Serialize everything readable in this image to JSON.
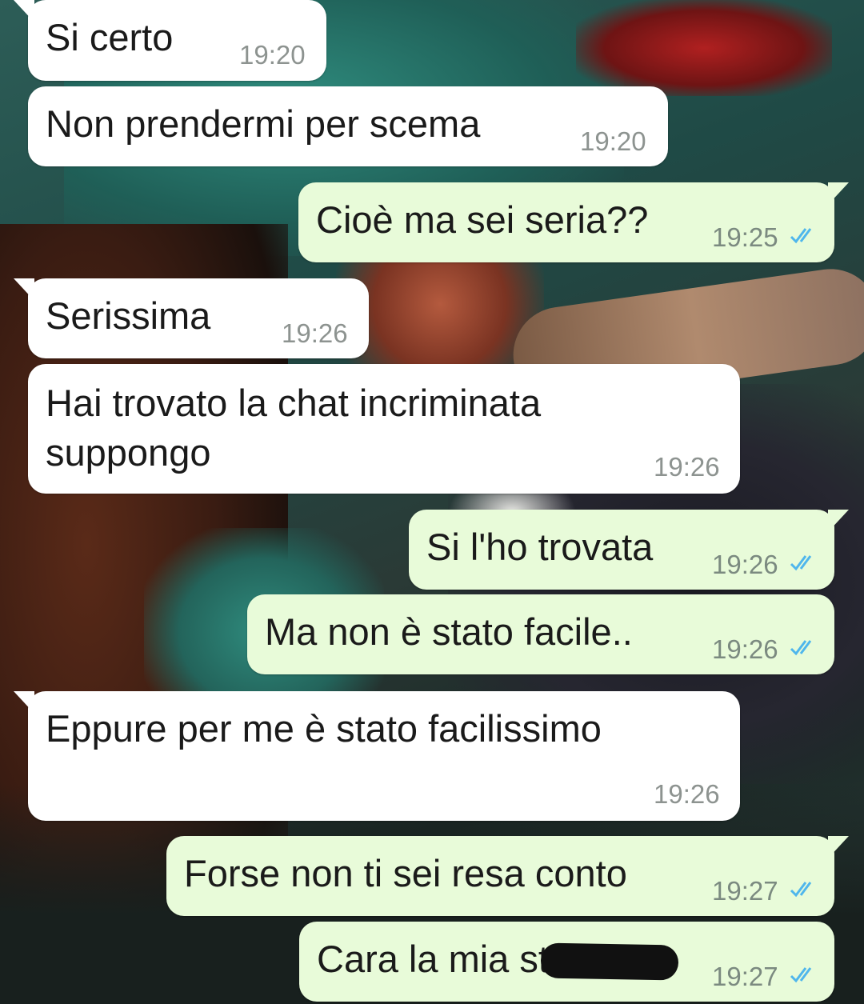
{
  "messages": [
    {
      "direction": "in",
      "text": "Si certo",
      "time": "19:20"
    },
    {
      "direction": "in",
      "text": "Non prendermi per scema",
      "time": "19:20"
    },
    {
      "direction": "out",
      "text": "Cioè ma sei seria??",
      "time": "19:25",
      "status": "double-check-icon"
    },
    {
      "direction": "in",
      "text": "Serissima",
      "time": "19:26"
    },
    {
      "direction": "in",
      "text": "Hai trovato la chat incriminata\nsuppongo",
      "time": "19:26"
    },
    {
      "direction": "out",
      "text": "Si l'ho trovata",
      "time": "19:26",
      "status": "double-check-icon"
    },
    {
      "direction": "out",
      "text": "Ma non è stato facile..",
      "time": "19:26",
      "status": "double-check-icon"
    },
    {
      "direction": "in",
      "text": "Eppure per me è stato facilissimo",
      "time": "19:26"
    },
    {
      "direction": "out",
      "text": "Forse non ti sei resa conto",
      "time": "19:27",
      "status": "double-check-icon"
    },
    {
      "direction": "out",
      "text": "Cara la mia st",
      "time": "19:27",
      "status": "double-check-icon"
    }
  ],
  "colors": {
    "incoming_bubble": "#ffffff",
    "outgoing_bubble": "#e8fbd9",
    "read_ticks": "#4fb6ec"
  }
}
